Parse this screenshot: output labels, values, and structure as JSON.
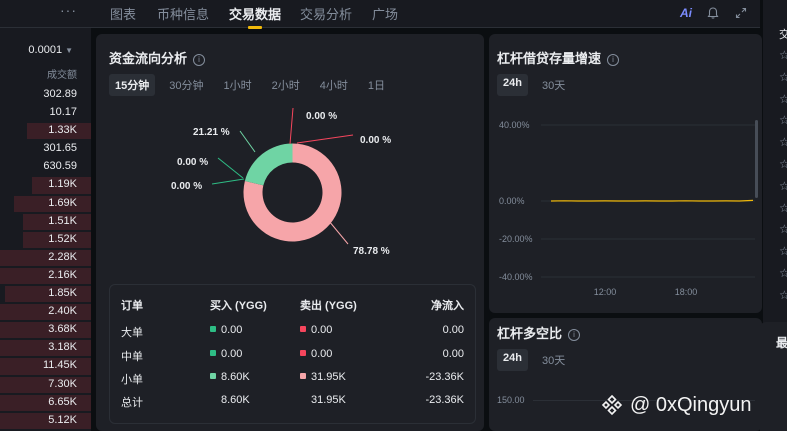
{
  "left_panel": {
    "menu_icon": "more-dots-icon",
    "precision": "0.0001",
    "volume_header": "成交额",
    "rows": [
      {
        "value": "302.89",
        "depth": 0.0
      },
      {
        "value": "10.17",
        "depth": 0.0
      },
      {
        "value": "1.33K",
        "depth": 0.7
      },
      {
        "value": "301.65",
        "depth": 0.0
      },
      {
        "value": "630.59",
        "depth": 0.0
      },
      {
        "value": "1.19K",
        "depth": 0.65
      },
      {
        "value": "1.69K",
        "depth": 0.85
      },
      {
        "value": "1.51K",
        "depth": 0.75
      },
      {
        "value": "1.52K",
        "depth": 0.75
      },
      {
        "value": "2.28K",
        "depth": 1.0
      },
      {
        "value": "2.16K",
        "depth": 1.0
      },
      {
        "value": "1.85K",
        "depth": 0.95
      },
      {
        "value": "2.40K",
        "depth": 1.0
      },
      {
        "value": "3.68K",
        "depth": 1.0
      },
      {
        "value": "3.18K",
        "depth": 1.0
      },
      {
        "value": "11.45K",
        "depth": 1.0
      },
      {
        "value": "7.30K",
        "depth": 1.0
      },
      {
        "value": "6.65K",
        "depth": 1.0
      },
      {
        "value": "5.12K",
        "depth": 1.0
      }
    ]
  },
  "tabs": [
    {
      "label": "图表",
      "active": false
    },
    {
      "label": "币种信息",
      "active": false
    },
    {
      "label": "交易数据",
      "active": true
    },
    {
      "label": "交易分析",
      "active": false
    },
    {
      "label": "广场",
      "active": false
    }
  ],
  "toolbar": {
    "ai_label": "Ai",
    "bell_icon": "bell-icon",
    "expand_icon": "expand-icon"
  },
  "fund_flow": {
    "title": "资金流向分析",
    "periods": [
      "15分钟",
      "30分钟",
      "1小时",
      "2小时",
      "4小时",
      "1日"
    ],
    "active_period": "15分钟",
    "chart_data": {
      "type": "pie",
      "slices": [
        {
          "label": "78.78 %",
          "value": 78.78,
          "color": "#f6a5a9"
        },
        {
          "label": "21.21 %",
          "value": 21.21,
          "color": "#6fd4a4"
        },
        {
          "label": "0.00 %",
          "value": 0.0,
          "color": "#f6465d"
        },
        {
          "label": "0.00 %",
          "value": 0.0,
          "color": "#f6465d"
        },
        {
          "label": "0.00 %",
          "value": 0.0,
          "color": "#2ebd85"
        },
        {
          "label": "0.00 %",
          "value": 0.0,
          "color": "#2ebd85"
        }
      ]
    },
    "table": {
      "headers": [
        "订单",
        "买入 (YGG)",
        "卖出 (YGG)",
        "净流入"
      ],
      "rows": [
        {
          "type": "大单",
          "buy": "0.00",
          "sell": "0.00",
          "net": "0.00",
          "buy_color": "#2ebd85",
          "sell_color": "#f6465d"
        },
        {
          "type": "中单",
          "buy": "0.00",
          "sell": "0.00",
          "net": "0.00",
          "buy_color": "#2ebd85",
          "sell_color": "#f6465d"
        },
        {
          "type": "小单",
          "buy": "8.60K",
          "sell": "31.95K",
          "net": "-23.36K",
          "buy_color": "#6fd4a4",
          "sell_color": "#f6a5a9"
        },
        {
          "type": "总计",
          "buy": "8.60K",
          "sell": "31.95K",
          "net": "-23.36K",
          "buy_color": "",
          "sell_color": ""
        }
      ]
    }
  },
  "margin_growth": {
    "title": "杠杆借贷存量增速",
    "periods": [
      "24h",
      "30天"
    ],
    "active_period": "24h",
    "chart_data": {
      "type": "line",
      "y_ticks": [
        "40.00%",
        "0.00%",
        "-20.00%",
        "-40.00%"
      ],
      "x_ticks": [
        "12:00",
        "18:00"
      ],
      "ylim": [
        -40,
        40
      ],
      "series": [
        {
          "values": [
            0.0,
            0.1,
            0.0,
            0.0,
            0.05,
            0.0,
            0.0,
            0.05,
            0.0,
            0.0,
            0.08,
            0.0,
            0.0,
            0.05,
            0.0,
            0.3
          ],
          "color": "#f0b90b"
        }
      ]
    }
  },
  "margin_ratio": {
    "title": "杠杆多空比",
    "periods": [
      "24h",
      "30天"
    ],
    "active_period": "24h",
    "y_ticks": [
      "150.00"
    ]
  },
  "right_strip": {
    "label": "交",
    "bottom_label": "最",
    "stars": 12
  },
  "watermark": {
    "text": "@ 0xQingyun"
  }
}
